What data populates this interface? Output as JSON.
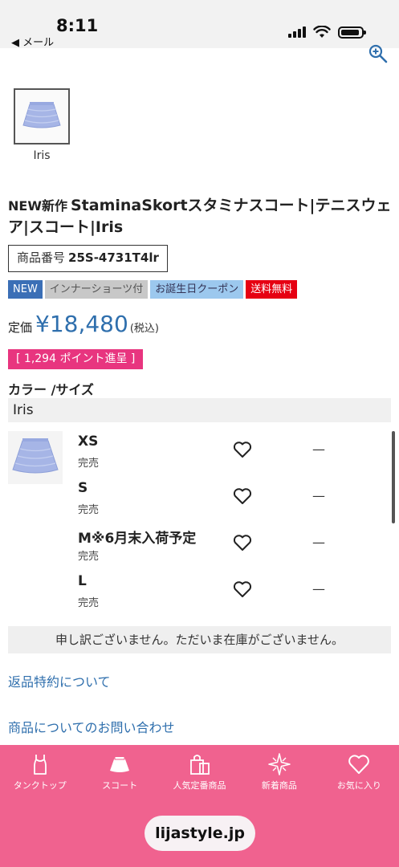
{
  "status_bar": {
    "time": "8:11",
    "back_label": "◀ メール"
  },
  "product": {
    "thumbnail_label": "Iris",
    "title_prefix": "NEW新作",
    "title": "StaminaSkortスタミナスコート|テニスウェア|スコート|Iris",
    "product_no_label": "商品番号",
    "product_no": "25S-4731T4lr",
    "tags": [
      "NEW",
      "インナーショーツ付",
      "お誕生日クーポン",
      "送料無料"
    ],
    "price_label": "定価",
    "price": "¥18,480",
    "tax_label": "(税込)",
    "points": "[ 1,294 ポイント進呈 ]"
  },
  "variant": {
    "heading": "カラー /サイズ",
    "color": "Iris",
    "sizes": [
      {
        "name": "XS",
        "stock": "完売",
        "dash": "—"
      },
      {
        "name": "S",
        "stock": "完売",
        "dash": "—"
      },
      {
        "name": "M※6月末入荷予定",
        "stock": "完売",
        "dash": "—"
      },
      {
        "name": "L",
        "stock": "完売",
        "dash": "—"
      }
    ]
  },
  "notice": "申し訳ございません。ただいま在庫がございません。",
  "links": {
    "returns": "返品特約について",
    "inquiry": "商品についてのお問い合わせ"
  },
  "bottom_nav": [
    {
      "label": "タンクトップ",
      "icon": "tank-top-icon"
    },
    {
      "label": "スコート",
      "icon": "skirt-icon"
    },
    {
      "label": "人気定番商品",
      "icon": "shopping-bag-icon"
    },
    {
      "label": "新着商品",
      "icon": "sparkle-icon"
    },
    {
      "label": "お気に入り",
      "icon": "heart-icon"
    }
  ],
  "url": "lijastyle.jp",
  "colors": {
    "accent_pink": "#f0628f",
    "price_blue": "#2f6fad",
    "points_pink": "#e8357f",
    "ship_red": "#e60012"
  }
}
